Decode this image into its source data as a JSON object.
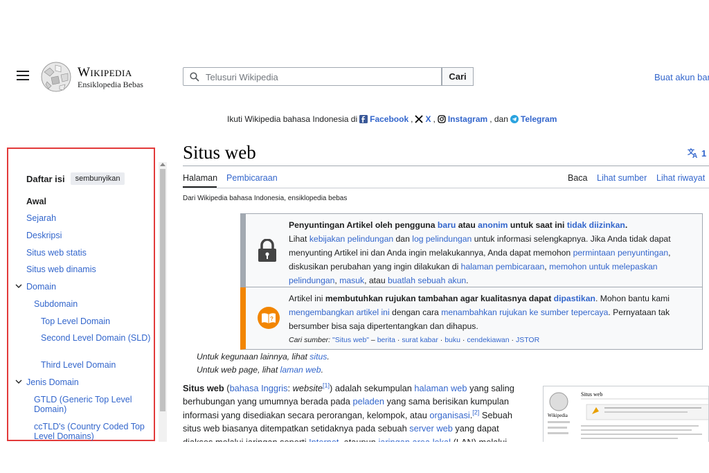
{
  "header": {
    "wordmark": "Wikipedia",
    "tagline": "Ensiklopedia Bebas",
    "search_placeholder": "Telusuri Wikipedia",
    "search_button": "Cari",
    "create_account": "Buat akun baru"
  },
  "follow_bar": {
    "prefix": "Ikuti Wikipedia bahasa Indonesia di",
    "facebook": "Facebook",
    "x": "X",
    "instagram": "Instagram",
    "and": ", dan",
    "telegram": "Telegram"
  },
  "toc": {
    "title": "Daftar isi",
    "hide": "sembunyikan",
    "items": [
      {
        "label": "Awal"
      },
      {
        "label": "Sejarah"
      },
      {
        "label": "Deskripsi"
      },
      {
        "label": "Situs web statis"
      },
      {
        "label": "Situs web dinamis"
      },
      {
        "label": "Domain"
      },
      {
        "label": "Subdomain"
      },
      {
        "label": "Top Level Domain"
      },
      {
        "label": "Second Level Domain (SLD)"
      },
      {
        "label": "Third Level Domain"
      },
      {
        "label": "Jenis Domain"
      },
      {
        "label": "GTLD (Generic Top Level Domain)"
      },
      {
        "label": "ccTLD's (Country Coded Top Level Domains)"
      }
    ]
  },
  "article": {
    "title": "Situs web",
    "lang_count": "1",
    "tabs": {
      "page": "Halaman",
      "talk": "Pembicaraan",
      "read": "Baca",
      "view_source": "Lihat sumber",
      "history": "Lihat riwayat"
    },
    "site_sub": "Dari Wikipedia bahasa Indonesia, ensiklopedia bebas",
    "protect_box": {
      "l1_a": "Penyuntingan Artikel oleh pengguna ",
      "l1_b": "baru",
      "l1_c": " atau ",
      "l1_d": "anonim",
      "l1_e": " untuk saat ini ",
      "l1_f": "tidak diizinkan",
      "l1_g": ".",
      "l2_a": "Lihat ",
      "l2_b": "kebijakan pelindungan",
      "l2_c": " dan ",
      "l2_d": "log pelindungan",
      "l2_e": " untuk informasi selengkapnya. Jika Anda tidak dapat",
      "l3": "menyunting Artikel ini dan Anda ingin melakukannya, Anda dapat memohon ",
      "l3_b": "permintaan penyuntingan",
      "l3_c": ",",
      "l4_a": "diskusikan perubahan yang ingin dilakukan di ",
      "l4_b": "halaman pembicaraan",
      "l4_c": ", ",
      "l4_d": "memohon untuk melepaskan",
      "l5_a": "pelindungan",
      "l5_b": ", ",
      "l5_c": "masuk",
      "l5_d": ", atau ",
      "l5_e": "buatlah sebuah akun",
      "l5_f": "."
    },
    "refs_box": {
      "l1_a": "Artikel ini ",
      "l1_b": "membutuhkan rujukan tambahan agar kualitasnya dapat ",
      "l1_c": "dipastikan",
      "l1_d": ". Mohon bantu kami",
      "l2_a": "mengembangkan artikel ini",
      "l2_b": " dengan cara ",
      "l2_c": "menambahkan rujukan ke sumber tepercaya",
      "l2_d": ". Pernyataan tak",
      "l3": "bersumber bisa saja dipertentangkan dan dihapus.",
      "src_label": "Cari sumber:",
      "src_query": "\"Situs web\"",
      "src_dash": " – ",
      "src_news": "berita",
      "src_sep": " · ",
      "src_paper": "surat kabar",
      "src_book": "buku",
      "src_scholar": "cendekiawan",
      "src_jstor": "JSTOR"
    },
    "hatnote1_a": "Untuk kegunaan lainnya, lihat ",
    "hatnote1_b": "situs",
    "hatnote1_c": ".",
    "hatnote2_a": "Untuk web page, lihat ",
    "hatnote2_b": "laman web",
    "hatnote2_c": ".",
    "para": {
      "bold": "Situs web",
      "a1": " (",
      "lnk1": "bahasa Inggris",
      "a2": ": ",
      "it": "website",
      "ref1": "[1]",
      "a3": ") adalah sekumpulan ",
      "lnk2": "halaman web",
      "a4": " yang saling berhubungan yang umumnya berada pada ",
      "lnk3": "peladen",
      "a5": " yang sama berisikan kumpulan informasi yang disediakan secara perorangan, kelompok, atau ",
      "lnk4": "organisasi",
      "a6": ".",
      "ref2": "[2]",
      "a7": " Sebuah situs web biasanya ditempatkan setidaknya pada sebuah ",
      "lnk5": "server web",
      "a8": " yang dapat diakses melalui jaringan seperti ",
      "lnk6": "Internet",
      "a9": ", ataupun ",
      "lnk7": "jaringan area lokal",
      "a10": " (LAN) melalui alamat Internet yang"
    },
    "thumb": {
      "title": "Situs web",
      "logo": "Wikipedia"
    }
  },
  "colors": {
    "link": "#3366cc",
    "toc_frame": "#e23a3a",
    "refs_bar": "#f28500",
    "protect_bar": "#a2a9b1"
  }
}
